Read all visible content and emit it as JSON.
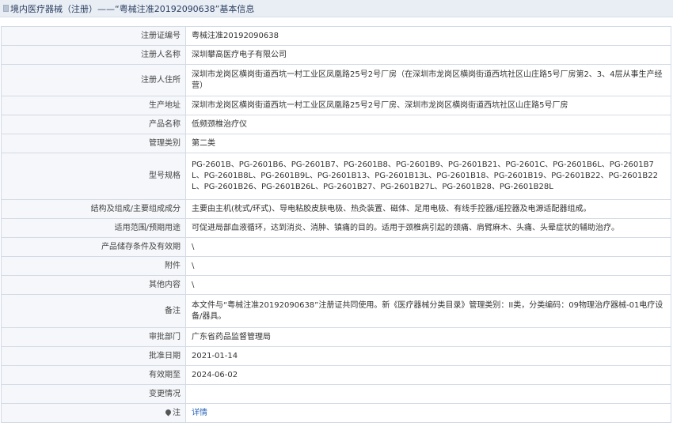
{
  "header": {
    "title": "境内医疗器械（注册）——“粤械注准20192090638”基本信息"
  },
  "rows": [
    {
      "label": "注册证编号",
      "value": "粤械注准20192090638"
    },
    {
      "label": "注册人名称",
      "value": "深圳攀高医疗电子有限公司"
    },
    {
      "label": "注册人住所",
      "value": "深圳市龙岗区横岗街道西坑一村工业区凤凰路25号2号厂房（在深圳市龙岗区横岗街道西坑社区山庄路5号厂房第2、3、4层从事生产经营）"
    },
    {
      "label": "生产地址",
      "value": "深圳市龙岗区横岗街道西坑一村工业区凤凰路25号2号厂房、深圳市龙岗区横岗街道西坑社区山庄路5号厂房"
    },
    {
      "label": "产品名称",
      "value": "低频颈椎治疗仪"
    },
    {
      "label": "管理类别",
      "value": "第二类"
    },
    {
      "label": "型号规格",
      "value": "PG-2601B、PG-2601B6、PG-2601B7、PG-2601B8、PG-2601B9、PG-2601B21、PG-2601C、PG-2601B6L、PG-2601B7L、PG-2601B8L、PG-2601B9L、PG-2601B13、PG-2601B13L、PG-2601B18、PG-2601B19、PG-2601B22、PG-2601B22L、PG-2601B26、PG-2601B26L、PG-2601B27、PG-2601B27L、PG-2601B28、PG-2601B28L"
    },
    {
      "label": "结构及组成/主要组成成分",
      "value": "主要由主机(枕式/环式)、导电粘胶皮肤电极、热灸装置、磁体、足用电极、有线手控器/遥控器及电源适配器组成。"
    },
    {
      "label": "适用范围/预期用途",
      "value": "可促进局部血液循环，达到消炎、消肿、镇痛的目的。适用于颈椎病引起的颈痛、肩臂麻木、头痛、头晕症状的辅助治疗。"
    },
    {
      "label": "产品储存条件及有效期",
      "value": "\\"
    },
    {
      "label": "附件",
      "value": "\\"
    },
    {
      "label": "其他内容",
      "value": "\\"
    },
    {
      "label": "备注",
      "value": "本文件与“粤械注准20192090638”注册证共同使用。新《医疗器械分类目录》管理类别：II类，分类编码：09物理治疗器械-01电疗设备/器具。"
    },
    {
      "label": "审批部门",
      "value": "广东省药品监督管理局"
    },
    {
      "label": "批准日期",
      "value": "2021-01-14"
    },
    {
      "label": "有效期至",
      "value": "2024-06-02"
    },
    {
      "label": "变更情况",
      "value": ""
    },
    {
      "label": "注",
      "value": "详情",
      "icon": "map-pin-icon"
    }
  ]
}
